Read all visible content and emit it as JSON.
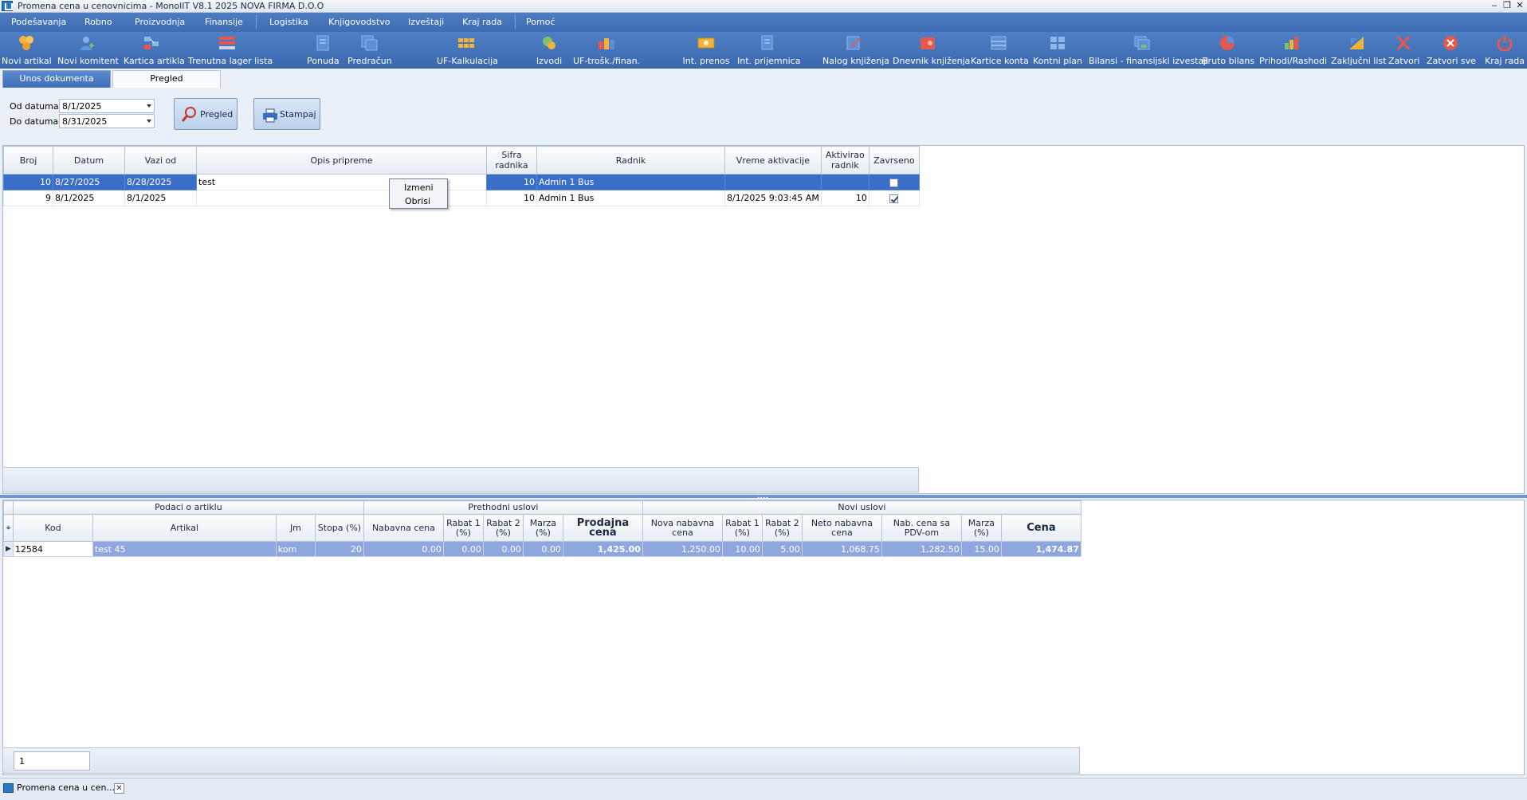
{
  "window": {
    "title": "Promena cena u cenovnicima - MonolIT V8.1 2025 NOVA FIRMA D.O.O",
    "minimize": "‒",
    "restore": "❐",
    "close": "✕"
  },
  "menu": [
    "Podešavanja",
    "Robno",
    "Proizvodnja",
    "Finansije",
    "Logistika",
    "Knjigovodstvo",
    "Izveštaji",
    "Kraj rada",
    "Pomoć"
  ],
  "toolbar": [
    {
      "label": "Novi artikal",
      "icon": "boxes-icon",
      "color": "#f0b43c"
    },
    {
      "label": "Novi komitent",
      "icon": "user-add-icon",
      "color": "#7fb2ea"
    },
    {
      "label": "Kartica artikla",
      "icon": "item-card-icon",
      "color": "#8fb6e8"
    },
    {
      "label": "Trenutna lager lista",
      "icon": "stock-list-icon",
      "color": "#e5584f"
    },
    {
      "label": "Ponuda",
      "icon": "offer-icon",
      "color": "#8fb6e8"
    },
    {
      "label": "Predračun",
      "icon": "proforma-icon",
      "color": "#8fb6e8"
    },
    {
      "label": "UF-Kalkulacija",
      "icon": "calculation-icon",
      "color": "#f0b43c"
    },
    {
      "label": "Izvodi",
      "icon": "statement-icon",
      "color": "#7dc36b"
    },
    {
      "label": "UF-trošk./finan.",
      "icon": "costs-icon",
      "color": "#e5584f"
    },
    {
      "label": "Int. prenos",
      "icon": "transfer-icon",
      "color": "#f0b43c"
    },
    {
      "label": "Int. prijemnica",
      "icon": "receipt-icon",
      "color": "#8fb6e8"
    },
    {
      "label": "Nalog knjiženja",
      "icon": "posting-order-icon",
      "color": "#8fb6e8"
    },
    {
      "label": "Dnevnik knjiženja",
      "icon": "journal-icon",
      "color": "#e5584f"
    },
    {
      "label": "Kartice konta",
      "icon": "account-cards-icon",
      "color": "#8fb6e8"
    },
    {
      "label": "Kontni plan",
      "icon": "chart-of-accounts-icon",
      "color": "#8fb6e8"
    },
    {
      "label": "Bilansi - finansijski izvestaji",
      "icon": "balance-sheet-icon",
      "color": "#7dc36b"
    },
    {
      "label": "Bruto bilans",
      "icon": "pie-chart-icon",
      "color": "#e5584f"
    },
    {
      "label": "Prihodi/Rashodi",
      "icon": "income-expense-icon",
      "color": "#f0b43c"
    },
    {
      "label": "Zaključni list",
      "icon": "closing-sheet-icon",
      "color": "#f0b43c"
    },
    {
      "label": "Zatvori",
      "icon": "close-x-icon",
      "color": "#e5584f"
    },
    {
      "label": "Zatvori sve",
      "icon": "close-all-icon",
      "color": "#e5584f"
    },
    {
      "label": "Kraj rada",
      "icon": "power-icon",
      "color": "#e5584f"
    }
  ],
  "tabs": [
    "Unos dokumenta",
    "Pregled"
  ],
  "filter": {
    "from_label": "Od datuma",
    "from_value": "8/1/2025",
    "to_label": "Do datuma",
    "to_value": "8/31/2025",
    "preview_button": "Pregled",
    "print_button": "Stampaj"
  },
  "upper_grid": {
    "columns": [
      "Broj",
      "Datum",
      "Vazi od",
      "Opis pripreme",
      "Sifra radnika",
      "Radnik",
      "Vreme aktivacije",
      "Aktivirao radnik",
      "Zavrseno"
    ],
    "rows": [
      {
        "broj": "10",
        "datum": "8/27/2025",
        "vazi_od": "8/28/2025",
        "opis": "test",
        "sifra": "10",
        "radnik": "Admin 1 Bus",
        "vreme": "",
        "aktivirao": "",
        "zavrseno": false,
        "selected": true
      },
      {
        "broj": "9",
        "datum": "8/1/2025",
        "vazi_od": "8/1/2025",
        "opis": "",
        "sifra": "10",
        "radnik": "Admin 1 Bus",
        "vreme": "8/1/2025 9:03:45 AM",
        "aktivirao": "10",
        "zavrseno": true,
        "selected": false
      }
    ]
  },
  "context_menu": [
    "Izmeni",
    "Obrisi"
  ],
  "lower_grid": {
    "groups": [
      "Podaci o artiklu",
      "Prethodni uslovi",
      "Novi uslovi"
    ],
    "columns": [
      "Kod",
      "Artikal",
      "Jm",
      "Stopa (%)",
      "Nabavna cena",
      "Rabat 1 (%)",
      "Rabat 2 (%)",
      "Marza (%)",
      "Prodajna cena",
      "Nova nabavna cena",
      "Rabat 1 (%)",
      "Rabat 2 (%)",
      "Neto nabavna cena",
      "Nab. cena sa PDV-om",
      "Marza (%)",
      "Cena"
    ],
    "rows": [
      [
        "12584",
        "test 45",
        "kom",
        "20",
        "0.00",
        "0.00",
        "0.00",
        "0.00",
        "1,425.00",
        "1,250.00",
        "10.00",
        "5.00",
        "1,068.75",
        "1,282.50",
        "15.00",
        "1,474.87"
      ]
    ],
    "page_input": "1"
  },
  "taskbar": {
    "task_label": "Promena cena u cen...",
    "close": "✕"
  }
}
